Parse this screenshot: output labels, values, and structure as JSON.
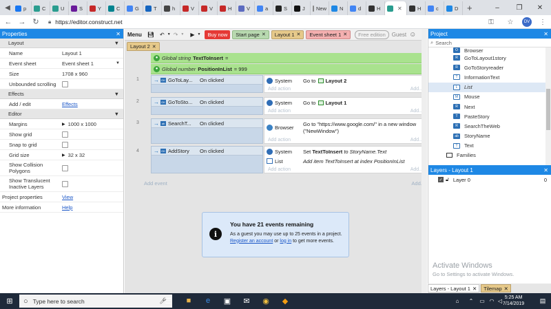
{
  "browser": {
    "tabs": [
      {
        "letter": "p",
        "color": "#1877f2"
      },
      {
        "letter": "C",
        "color": "#2a9d8f"
      },
      {
        "letter": "U",
        "color": "#2a9d8f"
      },
      {
        "letter": "S",
        "color": "#6a1b9a"
      },
      {
        "letter": "Y",
        "color": "#c62828"
      },
      {
        "letter": "C",
        "color": "#00838f"
      },
      {
        "letter": "G",
        "color": "#4285f4"
      },
      {
        "letter": "T",
        "color": "#1565c0"
      },
      {
        "letter": "h",
        "color": "#444444"
      },
      {
        "letter": "V",
        "color": "#c62828"
      },
      {
        "letter": "V",
        "color": "#c62828"
      },
      {
        "letter": "H",
        "color": "#c62828"
      },
      {
        "letter": "V",
        "color": "#5c6bc0"
      },
      {
        "letter": "a",
        "color": "#4285f4"
      },
      {
        "letter": "S",
        "color": "#222222"
      },
      {
        "letter": "J",
        "color": "#111111"
      },
      {
        "letter": "New",
        "color": "#888888"
      },
      {
        "letter": "N",
        "color": "#1e88e5"
      },
      {
        "letter": "d",
        "color": "#4285f4"
      },
      {
        "letter": "H",
        "color": "#333333"
      },
      {
        "letter": "",
        "color": "#2a9d8f",
        "active": true
      },
      {
        "letter": "H",
        "color": "#333333"
      },
      {
        "letter": "c",
        "color": "#4285f4"
      },
      {
        "letter": "D",
        "color": "#1e88e5"
      }
    ],
    "url": "https://editor.construct.net",
    "avatar": "DV"
  },
  "properties": {
    "title": "Properties",
    "sections": {
      "layout": "Layout",
      "effects": "Effects",
      "editor": "Editor"
    },
    "name": {
      "label": "Name",
      "value": "Layout 1"
    },
    "event_sheet": {
      "label": "Event sheet",
      "value": "Event sheet 1"
    },
    "size": {
      "label": "Size",
      "value": "1708 x 960"
    },
    "unbounded": {
      "label": "Unbounded scrolling"
    },
    "add_edit": {
      "label": "Add / edit",
      "value": "Effects"
    },
    "margins": {
      "label": "Margins",
      "value": "1000 x 1000"
    },
    "show_grid": {
      "label": "Show grid"
    },
    "snap_grid": {
      "label": "Snap to grid"
    },
    "grid_size": {
      "label": "Grid size",
      "value": "32 x 32"
    },
    "show_collision": {
      "label": "Show Collision Polygons"
    },
    "show_translucent": {
      "label": "Show Translucent Inactive Layers"
    },
    "project_props": {
      "label": "Project properties",
      "value": "View"
    },
    "more_info": {
      "label": "More information",
      "value": "Help"
    }
  },
  "toolbar": {
    "menu": "Menu",
    "buy_now": "Buy now",
    "start_page": "Start page",
    "layout1": "Layout 1",
    "event_sheet1": "Event sheet 1",
    "free_edition": "Free edition",
    "guest": "Guest"
  },
  "subtab": "Layout 2",
  "globals": [
    {
      "kind": "Global string",
      "name": "TextToInsert",
      "suffix": "="
    },
    {
      "kind": "Global number",
      "name": "PositionInList",
      "suffix": "= 999"
    }
  ],
  "events": [
    {
      "num": "1",
      "object": "GoToLay...",
      "trigger": "On clicked",
      "actions": [
        {
          "object": "System",
          "pre": "Go to ",
          "bold": "Layout 2",
          "post": ""
        }
      ]
    },
    {
      "num": "2",
      "object": "GoToSto...",
      "trigger": "On clicked",
      "actions": [
        {
          "object": "System",
          "pre": "Go to ",
          "bold": "Layout 1",
          "post": ""
        }
      ]
    },
    {
      "num": "3",
      "object": "SearchT...",
      "trigger": "On clicked",
      "actions": [
        {
          "object": "Browser",
          "pre": "Go to \"https://www.google.com/\" in a new window (\"NewWindow\")",
          "bold": "",
          "post": ""
        }
      ]
    },
    {
      "num": "4",
      "object": "AddStory",
      "trigger": "On clicked",
      "actions": [
        {
          "object": "System",
          "pre": "Set ",
          "bold": "TextToInsert",
          "post": " to StoryName.Text"
        },
        {
          "object": "List",
          "pre": "Add item TextToInsert at index PositionInList",
          "bold": "",
          "post": ""
        }
      ]
    }
  ],
  "add_action": "Add action",
  "add_dots": "Add...",
  "add_event": "Add event",
  "notice": {
    "title": "You have 21 events remaining",
    "body_pre": "As a guest you may use up to 25 events in a project. ",
    "register": "Register an account",
    "or": " or ",
    "login": "log in",
    "body_post": " to get more events."
  },
  "project": {
    "title": "Project",
    "search_placeholder": "Search",
    "items": [
      "Browser",
      "GoToLayout1story",
      "GoToStoryreader",
      "InformationText",
      "List",
      "Mouse",
      "Next",
      "PasteStory",
      "SearchTheWeb",
      "StoryName",
      "Text"
    ],
    "families": "Families"
  },
  "layers": {
    "title": "Layers - Layout 1",
    "row": {
      "name": "Layer 0",
      "count": "0"
    },
    "tabs": [
      "Layers - Layout 1",
      "Tilemap"
    ]
  },
  "watermark": {
    "line1": "Activate Windows",
    "line2": "Go to Settings to activate Windows."
  },
  "taskbar": {
    "search": "Type here to search",
    "time": "5:25 AM",
    "date": "7/14/2019"
  }
}
